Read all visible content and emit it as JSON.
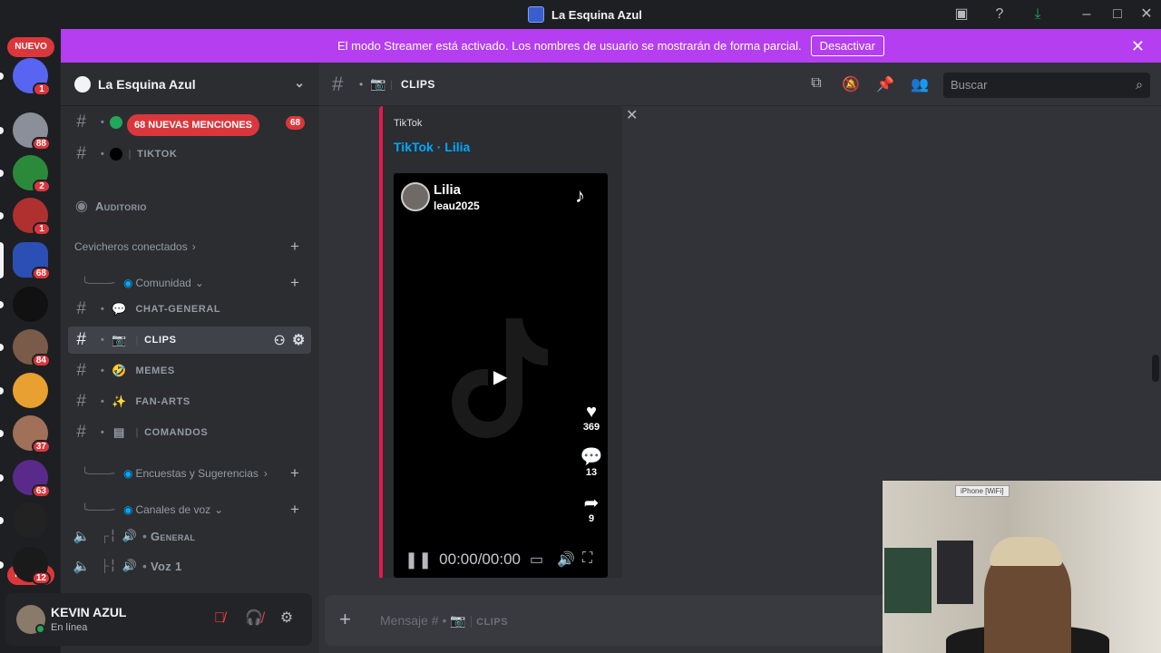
{
  "window": {
    "title": "La Esquina Azul",
    "controls": [
      "minimize",
      "maximize",
      "close"
    ]
  },
  "banner": {
    "text": "El modo Streamer está activado. Los nombres de usuario se mostrarán de forma parcial.",
    "button": "Desactivar"
  },
  "rail": {
    "nuevo_label": "NUEVO",
    "servers": [
      {
        "badge": "1",
        "color": "#5865f2"
      },
      {
        "badge": "88",
        "color": "#8a8f99"
      },
      {
        "badge": "2",
        "color": "#2a8a3a"
      },
      {
        "badge": "1",
        "color": "#b03030"
      },
      {
        "badge": "68",
        "color": "#2b4fb5"
      },
      {
        "badge": "",
        "color": "#111111"
      },
      {
        "badge": "84",
        "color": "#7a5a48"
      },
      {
        "badge": "",
        "color": "#e8a030"
      },
      {
        "badge": "37",
        "color": "#a07058"
      },
      {
        "badge": "63",
        "color": "#5a2a8a"
      },
      {
        "badge": "",
        "color": "#222222"
      },
      {
        "badge": "12",
        "color": "#1a1a1a"
      }
    ],
    "bottom_badge": "18"
  },
  "sidebar": {
    "guild_name": "La Esquina Azul",
    "mentions_pill": "68 NUEVAS MENCIONES",
    "mentions_count": "68",
    "top_channels": [
      {
        "name": "TIKTOK"
      }
    ],
    "stage": "Auditorio",
    "categories": {
      "connected": "Cevicheros conectados",
      "comunidad": "Comunidad",
      "encuestas": "Encuestas y Sugerencias",
      "voz": "Canales de voz"
    },
    "channels": [
      {
        "name": "CHAT-GENERAL",
        "emoji": "💬"
      },
      {
        "name": "CLIPS",
        "emoji": "📷"
      },
      {
        "name": "MEMES",
        "emoji": "🤣"
      },
      {
        "name": "FAN-ARTS",
        "emoji": "✨"
      },
      {
        "name": "COMANDOS",
        "emoji": "▤"
      }
    ],
    "voice": [
      {
        "name": "General"
      },
      {
        "name": "Voz 1"
      }
    ]
  },
  "user": {
    "name": "KEVIN AZUL",
    "status": "En línea"
  },
  "header": {
    "channel": "CLIPS",
    "search_placeholder": "Buscar"
  },
  "embed": {
    "provider": "TikTok",
    "title": "TikTok · Lilia",
    "author_name": "Lilia",
    "author_handle": "leau2025",
    "likes": "369",
    "comments": "13",
    "shares": "9",
    "time": "00:00/00:00"
  },
  "composer": {
    "placeholder_prefix": "Mensaje #",
    "placeholder_channel": "CLIPS"
  },
  "webcam": {
    "label": "iPhone [WiFi]"
  },
  "colors": {
    "banner": "#b43ef0",
    "badge": "#da373c",
    "link": "#00a8fc",
    "embed_bar": "#e7194d",
    "online": "#23a55a"
  }
}
